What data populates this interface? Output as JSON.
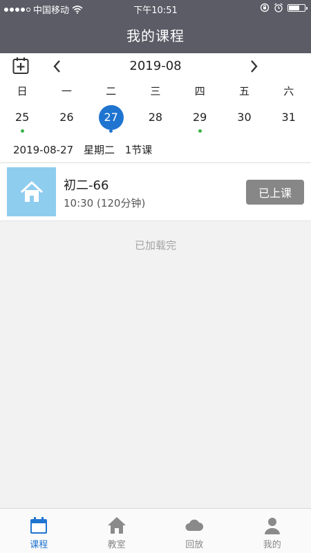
{
  "status_bar": {
    "carrier": "中国移动",
    "time": "下午10:51",
    "battery_level": 0.7
  },
  "header": {
    "title": "我的课程"
  },
  "calendar": {
    "month": "2019-08",
    "weekdays": [
      "日",
      "一",
      "二",
      "三",
      "四",
      "五",
      "六"
    ],
    "dates": [
      {
        "day": "25",
        "selected": false,
        "dot": "green"
      },
      {
        "day": "26",
        "selected": false,
        "dot": null
      },
      {
        "day": "27",
        "selected": true,
        "dot": "blue"
      },
      {
        "day": "28",
        "selected": false,
        "dot": null
      },
      {
        "day": "29",
        "selected": false,
        "dot": "green"
      },
      {
        "day": "30",
        "selected": false,
        "dot": null
      },
      {
        "day": "31",
        "selected": false,
        "dot": null
      }
    ],
    "summary": {
      "date": "2019-08-27",
      "weekday": "星期二",
      "count": "1节课"
    }
  },
  "courses": [
    {
      "name": "初二-66",
      "time": "10:30 (120分钟)",
      "status": "已上课",
      "thumb_icon": "home-icon"
    }
  ],
  "list_footer": "已加载完",
  "tabs": [
    {
      "label": "课程",
      "icon": "calendar-icon",
      "active": true
    },
    {
      "label": "教室",
      "icon": "home-icon",
      "active": false
    },
    {
      "label": "回放",
      "icon": "cloud-icon",
      "active": false
    },
    {
      "label": "我的",
      "icon": "person-icon",
      "active": false
    }
  ],
  "colors": {
    "header_bg": "#5b5c66",
    "accent": "#1f74d0",
    "event_dot": "#3cb44b",
    "status_button": "#878787",
    "thumb_bg": "#8fcdef"
  }
}
